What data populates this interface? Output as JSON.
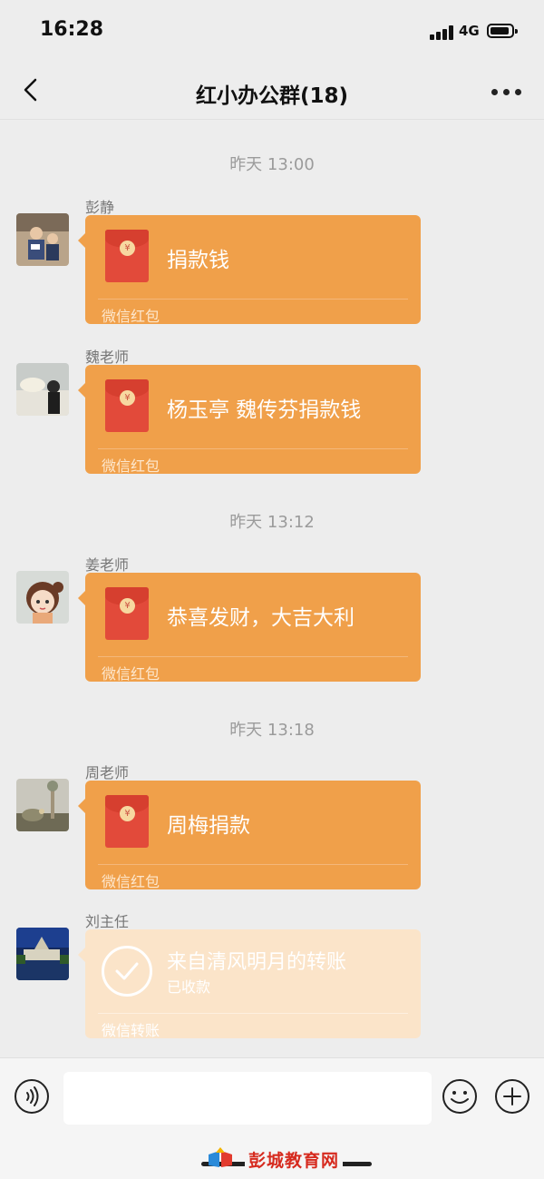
{
  "status_bar": {
    "time": "16:28",
    "network": "4G"
  },
  "nav": {
    "title": "红小办公群(18)"
  },
  "timestamps": [
    "昨天 13:00",
    "昨天 13:12",
    "昨天 13:18"
  ],
  "messages": [
    {
      "sender": "彭静",
      "title": "捐款钱",
      "footer": "微信红包"
    },
    {
      "sender": "魏老师",
      "title": "杨玉亭 魏传芬捐款钱",
      "footer": "微信红包"
    },
    {
      "sender": "姜老师",
      "title": "恭喜发财，大吉大利",
      "footer": "微信红包"
    },
    {
      "sender": "周老师",
      "title": "周梅捐款",
      "footer": "微信红包"
    },
    {
      "sender": "刘主任",
      "title": "来自清风明月的转账",
      "subtitle": "已收款",
      "footer": "微信转账"
    }
  ],
  "envelope_seal": "¥",
  "input": {
    "value": ""
  },
  "watermark": {
    "text": "彭城教育网"
  },
  "colors": {
    "red_packet_bubble": "#f0a04a",
    "transfer_bubble": "#fbe4c9",
    "packet_red": "#e24a3a"
  },
  "icons": {
    "back": "chevron-left-icon",
    "more": "more-icon",
    "voice": "voice-icon",
    "emoji": "emoji-icon",
    "plus": "plus-icon",
    "received": "check-icon"
  }
}
